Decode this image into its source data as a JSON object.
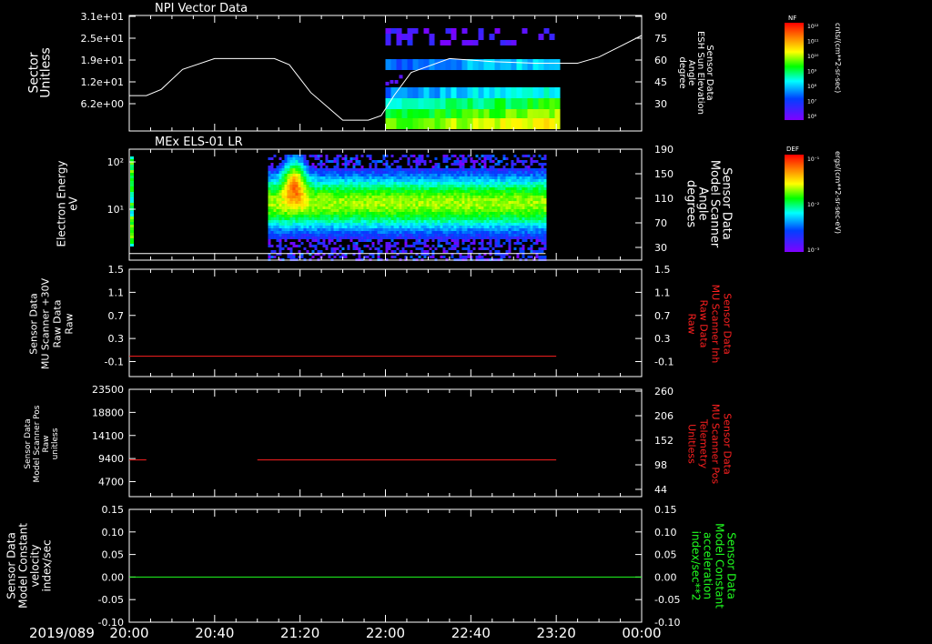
{
  "page": {
    "date_label": "2019/089"
  },
  "time_axis": {
    "start_minutes": 0,
    "end_minutes": 240,
    "tick_labels": [
      {
        "t": 0,
        "label": "20:00"
      },
      {
        "t": 40,
        "label": "20:40"
      },
      {
        "t": 80,
        "label": "21:20"
      },
      {
        "t": 120,
        "label": "22:00"
      },
      {
        "t": 160,
        "label": "22:40"
      },
      {
        "t": 200,
        "label": "23:20"
      },
      {
        "t": 240,
        "label": "00:00"
      }
    ]
  },
  "colors": {
    "background": "#000000",
    "axis": "#ffffff",
    "red_trace": "#ff2020",
    "green_trace": "#20ff20",
    "white_trace": "#ffffff"
  },
  "colorbars": [
    {
      "name": "colorbar-nf",
      "title": "NF",
      "unit": "cnts/(cm**2-sr-sec)",
      "ticks": [
        "10¹²",
        "10¹¹",
        "10¹⁰",
        "10⁹",
        "10⁸",
        "10⁷",
        "10⁶"
      ]
    },
    {
      "name": "colorbar-def",
      "title": "DEF",
      "unit": "ergs/(cm**2-sr-sec-eV)",
      "ticks": [
        "10⁻¹",
        "10⁻²",
        "10⁻³"
      ]
    }
  ],
  "chart_data": [
    {
      "type": "heatmap",
      "panel_title": "NPI Vector Data",
      "ylabel_left": [
        "Sector",
        "Unitless"
      ],
      "yticks_left": [
        "3.1e+01",
        "2.5e+01",
        "1.9e+01",
        "1.2e+01",
        "6.2e+00"
      ],
      "ylabel_right": [
        "Sensor Data",
        "ESH Sun Elevation",
        "Angle",
        "degree"
      ],
      "yticks_right": [
        "90",
        "75",
        "60",
        "45",
        "30"
      ],
      "ylim_right": [
        15,
        90
      ],
      "heatmap_time_range": [
        120,
        200
      ],
      "line": {
        "name": "Sensor Data ESH Sun Elevation Angle",
        "t": [
          0,
          8,
          15,
          25,
          40,
          55,
          68,
          75,
          85,
          100,
          112,
          118,
          124,
          132,
          150,
          170,
          190,
          210,
          220,
          230,
          240
        ],
        "values": [
          38,
          38,
          42,
          55,
          62,
          62,
          62,
          58,
          40,
          22,
          22,
          25,
          38,
          53,
          62,
          60,
          59,
          59,
          63,
          70,
          77
        ]
      }
    },
    {
      "type": "heatmap",
      "panel_title": "MEx ELS-01 LR",
      "ylabel_left": [
        "Electron Energy",
        "eV"
      ],
      "yticks_left": [
        "10²",
        "10¹"
      ],
      "ylabel_right": [
        "Sensor Data",
        "Model Scanner",
        "Angle",
        "degrees"
      ],
      "yticks_right": [
        "190",
        "150",
        "110",
        "70",
        "30"
      ],
      "ylim_right": [
        0,
        190
      ],
      "heatmap_time_range": [
        65,
        195
      ],
      "line": {
        "name": "Model Scanner Angle",
        "t": [
          0,
          195
        ],
        "values": [
          5,
          5
        ]
      }
    },
    {
      "type": "line",
      "ylabel_left": [
        "Sensor Data",
        "MU Scanner +30V",
        "Raw Data",
        "Raw"
      ],
      "yticks_left": [
        "1.5",
        "1.1",
        "0.7",
        "0.3",
        "-0.1"
      ],
      "ylabel_right": [
        "Sensor Data",
        "MU Scanner Inh",
        "Raw Data",
        "Raw"
      ],
      "yticks_right": [
        "1.5",
        "1.1",
        "0.7",
        "0.3",
        "-0.1"
      ],
      "ylim": [
        -0.35,
        1.5
      ],
      "series": [
        {
          "name": "Sensor Data MU Scanner Inh Raw Data",
          "t": [
            0,
            200
          ],
          "values": [
            0,
            0
          ]
        }
      ]
    },
    {
      "type": "line",
      "ylabel_left": [
        "Sensor Data",
        "Model Scanner Pos",
        "Raw",
        "unitless"
      ],
      "yticks_left": [
        "23500",
        "18800",
        "14100",
        "9400",
        "4700"
      ],
      "ylabel_right": [
        "Sensor Data",
        "MU Scanner Pos",
        "Telemetry",
        "Unitless"
      ],
      "yticks_right": [
        "260",
        "206",
        "152",
        "98",
        "44"
      ],
      "ylim": [
        0,
        23500
      ],
      "series": [
        {
          "name": "Sensor Data MU Scanner Pos Telemetry",
          "segments": [
            {
              "t": [
                0,
                8
              ]
            },
            {
              "t": [
                60,
                200
              ]
            }
          ],
          "value": 8200
        }
      ]
    },
    {
      "type": "line",
      "ylabel_left": [
        "Sensor Data",
        "Model Constant",
        "velocity",
        "index/sec"
      ],
      "yticks_left": [
        "0.15",
        "0.10",
        "0.05",
        "0.00",
        "-0.05",
        "-0.10"
      ],
      "ylabel_right": [
        "Sensor Data",
        "Model Constant",
        "acceleration",
        "index/sec**2"
      ],
      "yticks_right": [
        "0.15",
        "0.10",
        "0.05",
        "0.00",
        "-0.05",
        "-0.10"
      ],
      "ylim": [
        -0.1,
        0.15
      ],
      "series": [
        {
          "name": "Sensor Data Model Constant acceleration",
          "t": [
            0,
            240
          ],
          "values": [
            0,
            0
          ]
        }
      ]
    }
  ]
}
